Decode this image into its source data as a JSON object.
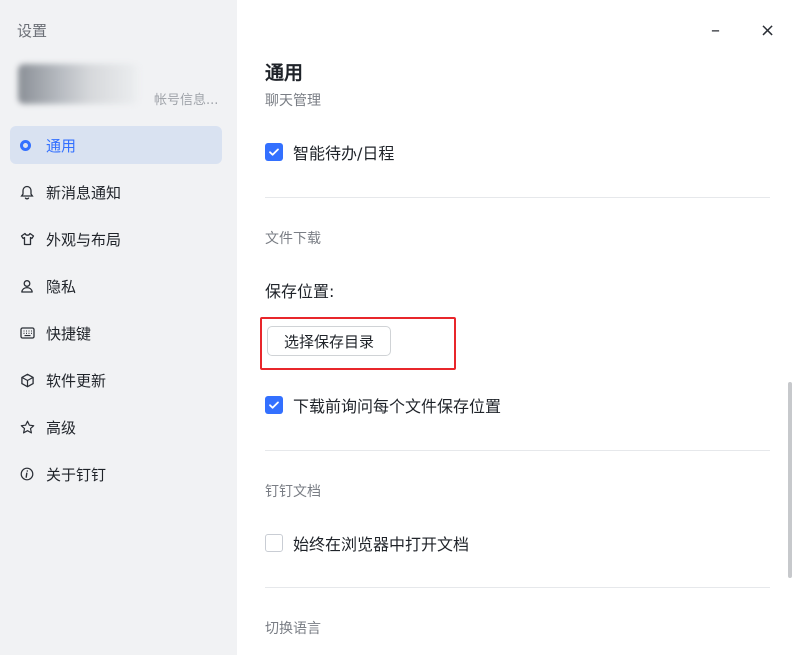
{
  "sidebar": {
    "title": "设置",
    "account_text": "帐号信息...",
    "items": [
      {
        "label": "通用",
        "icon": "settings-dot-icon",
        "active": true
      },
      {
        "label": "新消息通知",
        "icon": "bell-icon"
      },
      {
        "label": "外观与布局",
        "icon": "shirt-icon"
      },
      {
        "label": "隐私",
        "icon": "person-icon"
      },
      {
        "label": "快捷键",
        "icon": "keyboard-icon"
      },
      {
        "label": "软件更新",
        "icon": "box-icon"
      },
      {
        "label": "高级",
        "icon": "star-icon"
      },
      {
        "label": "关于钉钉",
        "icon": "info-icon"
      }
    ]
  },
  "window": {
    "minimize": "–",
    "close": "×"
  },
  "main": {
    "section_title": "通用",
    "chat_management": "聊天管理",
    "smart_todo": "智能待办/日程",
    "file_download": "文件下载",
    "save_location": "保存位置:",
    "choose_dir_button": "选择保存目录",
    "ask_each_file": "下载前询问每个文件保存位置",
    "dingtalk_docs": "钉钉文档",
    "open_in_browser": "始终在浏览器中打开文档",
    "switch_language": "切换语言"
  },
  "colors": {
    "accent": "#3370ff",
    "highlight": "#e8262b",
    "sidebar_bg": "#f1f2f4"
  }
}
